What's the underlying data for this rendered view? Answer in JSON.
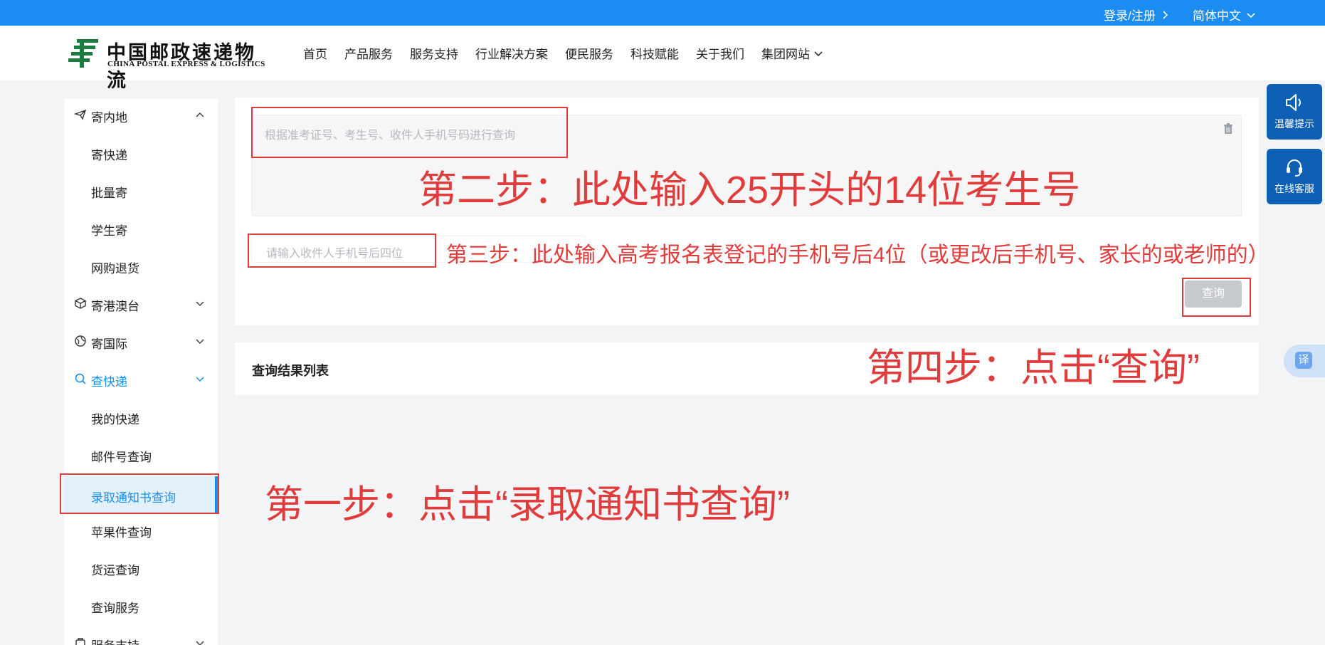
{
  "topbar": {
    "login": "登录/注册",
    "language": "简体中文"
  },
  "logo": {
    "cn": "中国邮政速递物流",
    "en": "CHINA POSTAL EXPRESS & LOGISTICS"
  },
  "nav": {
    "items": [
      "首页",
      "产品服务",
      "服务支持",
      "行业解决方案",
      "便民服务",
      "科技赋能",
      "关于我们",
      "集团网站"
    ]
  },
  "sidebar": {
    "group_send_domestic": "寄内地",
    "send_express": "寄快递",
    "bulk_send": "批量寄",
    "student_send": "学生寄",
    "online_return": "网购退货",
    "group_hk_macao_tw": "寄港澳台",
    "group_international": "寄国际",
    "group_track": "查快递",
    "my_express": "我的快递",
    "mail_number_query": "邮件号查询",
    "admission_letter_query": "录取通知书查询",
    "apple_query": "苹果件查询",
    "freight_query": "货运查询",
    "query_service": "查询服务",
    "group_service_support": "服务支持"
  },
  "form": {
    "textarea_placeholder": "根据准考证号、考生号、收件人手机号码进行查询",
    "phone_placeholder": "请输入收件人手机号后四位",
    "query_button": "查询"
  },
  "results": {
    "title": "查询结果列表"
  },
  "floating": {
    "tips": "温馨提示",
    "service": "在线客服",
    "translate": "译"
  },
  "annotations": {
    "step1": "第一步：点击“录取通知书查询”",
    "step2": "第二步：此处输入25开头的14位考生号",
    "step3": "第三步：此处输入高考报名表登记的手机号后4位（或更改后手机号、家长的或老师的）",
    "step4": "第四步：点击“查询”"
  },
  "colors": {
    "primary": "#1a8cf2",
    "annotation": "#e03c3c",
    "logo_green": "#1b7c3d"
  }
}
